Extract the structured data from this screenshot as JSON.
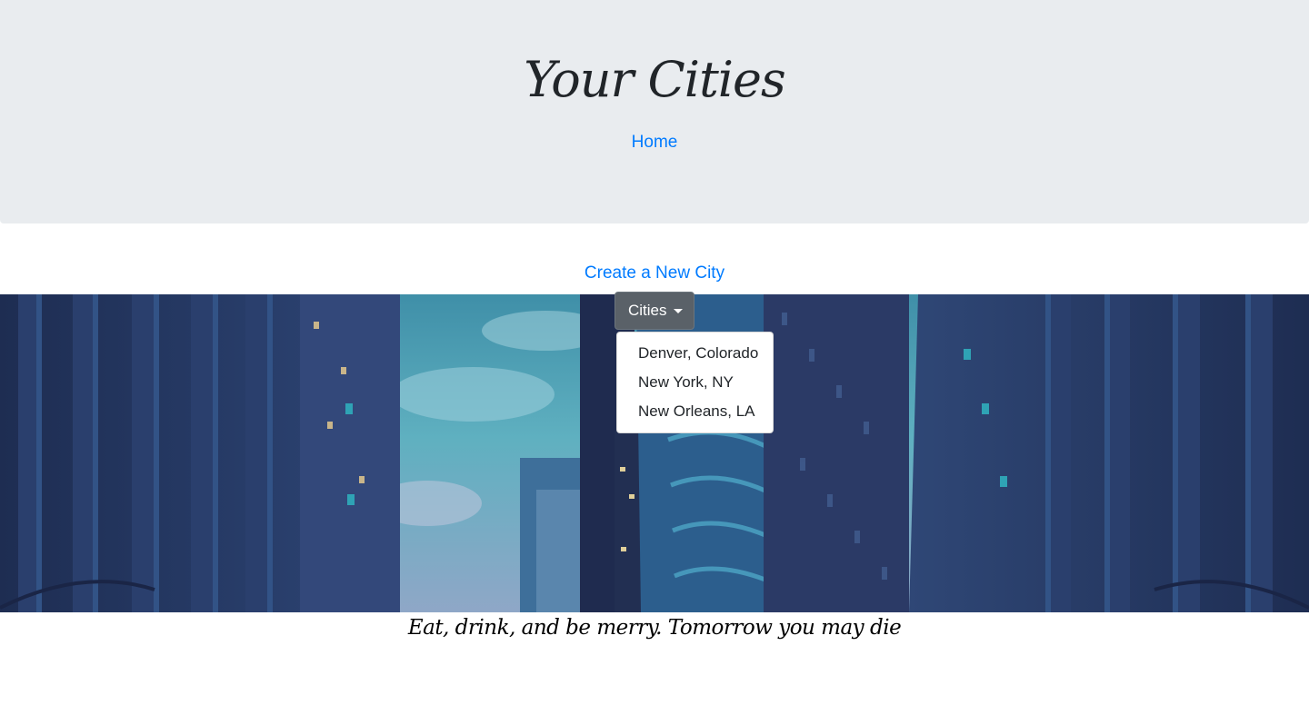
{
  "header": {
    "title": "Your Cities",
    "home_link": "Home"
  },
  "main": {
    "create_link": "Create a New City",
    "dropdown": {
      "label": "Cities",
      "items": [
        "Denver, Colorado",
        "New York, NY",
        "New Orleans, LA"
      ]
    }
  },
  "footer": {
    "quote": "Eat, drink, and be merry. Tomorrow you may die"
  },
  "colors": {
    "link": "#007bff",
    "jumbotron_bg": "#e9ecef",
    "button_bg": "#5a6168"
  },
  "icons": {
    "dropdown": "caret-down-icon"
  }
}
